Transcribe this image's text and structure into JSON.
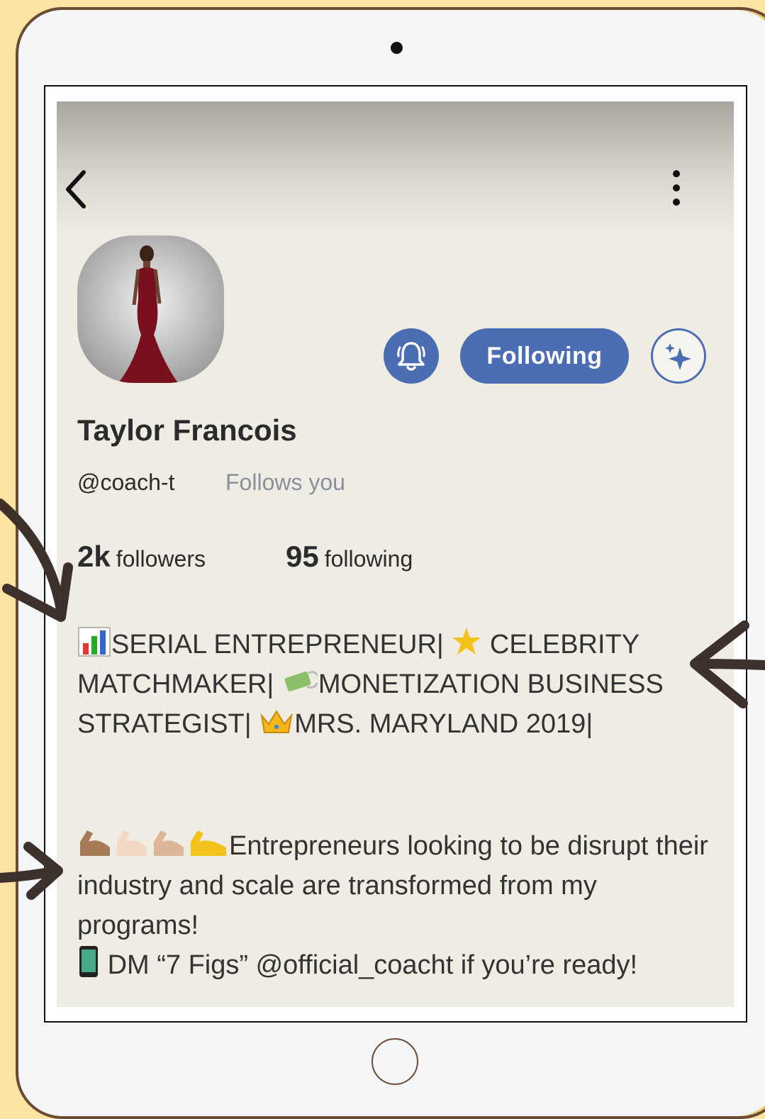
{
  "profile": {
    "name": "Taylor Francois",
    "handle": "@coach-t",
    "follows_you": "Follows you",
    "following_button": "Following",
    "followers_count": "2k",
    "followers_label": "followers",
    "following_count": "95",
    "following_label": "following"
  },
  "bio": {
    "part1": "SERIAL ENTREPRENEUR|",
    "part2": "CELEBRITY MATCHMAKER|",
    "part3": "MONETIZATION BUSINESS STRATEGIST|",
    "part4": "MRS. MARYLAND 2019|",
    "line2a": "Entrepreneurs looking to be disrupt their industry and scale are transformed from my programs!",
    "line3": "DM “7 Figs” @official_coacht if you’re ready!"
  },
  "colors": {
    "accent": "#4a6db3",
    "screen_bg": "#efede3",
    "page_bg": "#fde3a2",
    "frame": "#6b4a36"
  },
  "icons": [
    "back-chevron-icon",
    "more-vertical-icon",
    "bell-icon",
    "sparkle-icon",
    "bar-chart-emoji",
    "star-emoji",
    "money-emoji",
    "crown-emoji",
    "flexed-biceps-emoji",
    "phone-emoji"
  ]
}
